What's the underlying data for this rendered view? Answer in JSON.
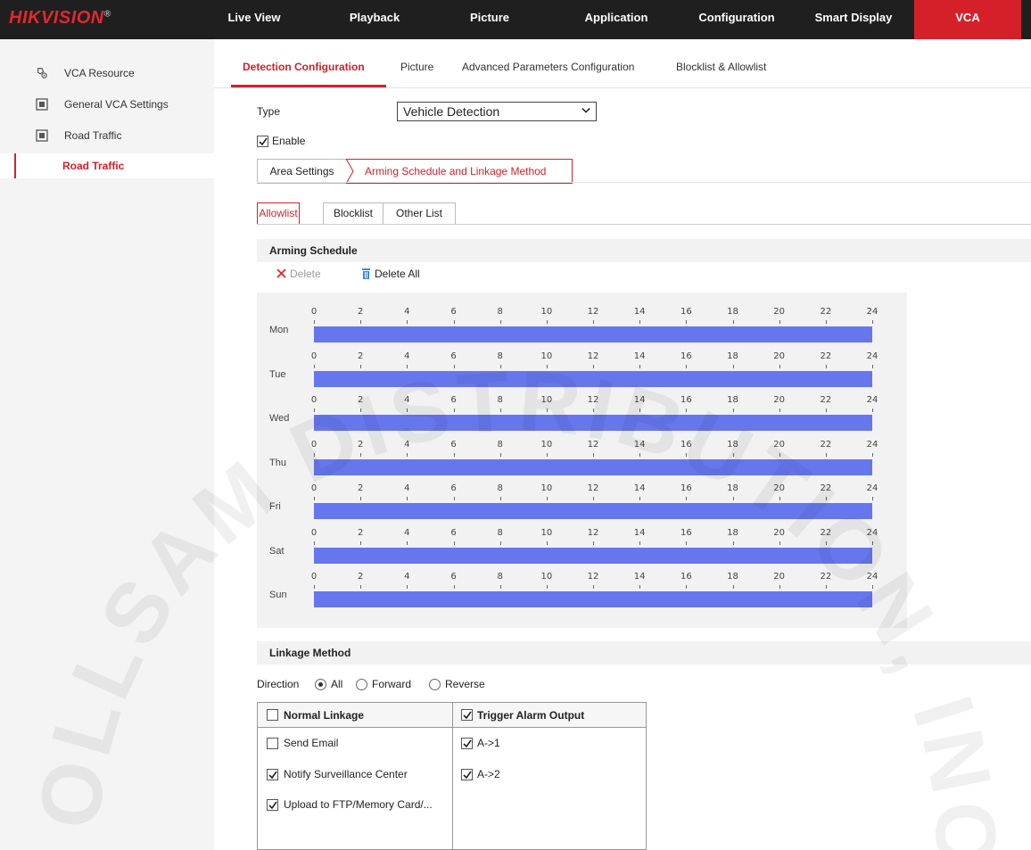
{
  "brand": {
    "logo_red": "HIK",
    "logo_rest": "VISION",
    "logo_mark": "®",
    "accent": "#d5202a"
  },
  "nav": {
    "items": [
      "Live View",
      "Playback",
      "Picture",
      "Application",
      "Configuration",
      "Smart Display",
      "VCA"
    ],
    "active": "VCA"
  },
  "sidebar": {
    "items": [
      {
        "label": "VCA Resource",
        "icon": "camera-cog-icon"
      },
      {
        "label": "General VCA Settings",
        "icon": "grid-icon"
      },
      {
        "label": "Road Traffic",
        "icon": "grid-icon"
      },
      {
        "label": "Road Traffic",
        "icon": "none",
        "active": true
      }
    ]
  },
  "tabs": [
    "Detection Configuration",
    "Picture",
    "Advanced Parameters Configuration",
    "Blocklist & Allowlist"
  ],
  "form": {
    "type_label": "Type",
    "type_value": "Vehicle Detection",
    "enable_label": "Enable",
    "enable_checked": true
  },
  "subtabs": {
    "area": "Area Settings",
    "arming": "Arming Schedule and Linkage Method"
  },
  "list_tabs": [
    "Allowlist",
    "Blocklist",
    "Other List"
  ],
  "arming": {
    "title": "Arming Schedule",
    "delete_label": "Delete",
    "delete_all_label": "Delete All",
    "hours": [
      "0",
      "2",
      "4",
      "6",
      "8",
      "10",
      "12",
      "14",
      "16",
      "18",
      "20",
      "22",
      "24"
    ],
    "days": [
      {
        "label": "Mon",
        "from": 0,
        "to": 24
      },
      {
        "label": "Tue",
        "from": 0,
        "to": 24
      },
      {
        "label": "Wed",
        "from": 0,
        "to": 24
      },
      {
        "label": "Thu",
        "from": 0,
        "to": 24
      },
      {
        "label": "Fri",
        "from": 0,
        "to": 24
      },
      {
        "label": "Sat",
        "from": 0,
        "to": 24
      },
      {
        "label": "Sun",
        "from": 0,
        "to": 24
      }
    ],
    "bar_color": "#6677ee"
  },
  "linkage": {
    "title": "Linkage Method",
    "direction_label": "Direction",
    "directions": [
      "All",
      "Forward",
      "Reverse"
    ],
    "direction_selected": "All",
    "normal_header": "Normal Linkage",
    "normal_header_checked": false,
    "alarm_header": "Trigger Alarm Output",
    "alarm_header_checked": true,
    "normal_items": [
      {
        "label": "Send Email",
        "checked": false
      },
      {
        "label": "Notify Surveillance Center",
        "checked": true
      },
      {
        "label": "Upload to FTP/Memory Card/...",
        "checked": true
      }
    ],
    "alarm_items": [
      {
        "label": "A->1",
        "checked": true
      },
      {
        "label": "A->2",
        "checked": true
      }
    ]
  },
  "watermark": {
    "text": "COLLSAM DISTRIBUTION, INC."
  }
}
